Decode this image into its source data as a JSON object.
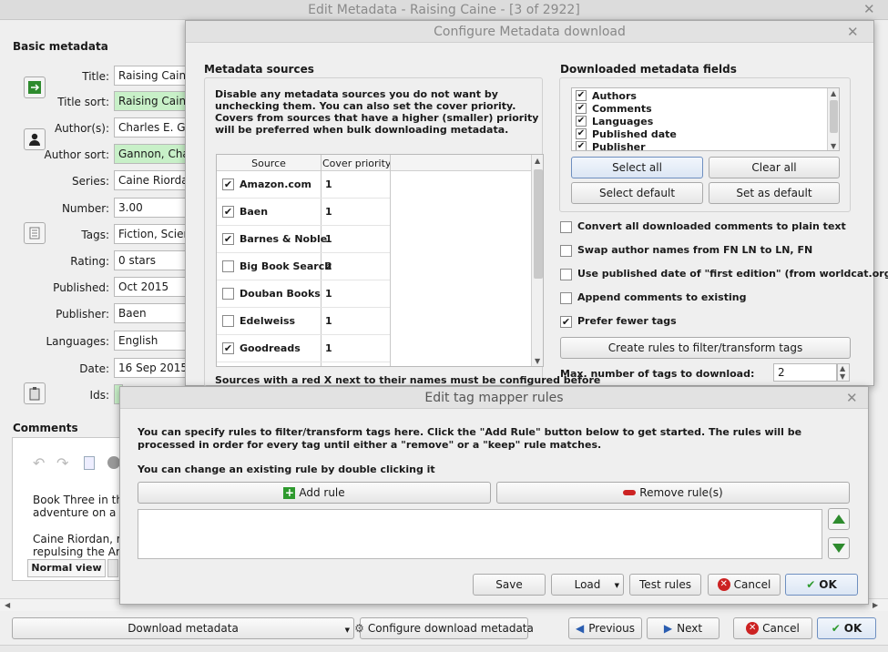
{
  "main_window": {
    "title": "Edit Metadata - Raising Caine -  [3 of 2922]"
  },
  "basic_metadata": {
    "heading": "Basic metadata",
    "labels": {
      "title": "Title:",
      "title_sort": "Title sort:",
      "authors": "Author(s):",
      "author_sort": "Author sort:",
      "series": "Series:",
      "number": "Number:",
      "tags": "Tags:",
      "rating": "Rating:",
      "published": "Published:",
      "publisher": "Publisher:",
      "languages": "Languages:",
      "date": "Date:",
      "ids": "Ids:"
    },
    "values": {
      "title": "Raising Caine",
      "title_sort": "Raising Caine",
      "authors": "Charles E. Gannon",
      "author_sort": "Gannon, Charles E.",
      "series": "Caine Riordan",
      "number": "3.00",
      "tags": "Fiction, Science Fiction",
      "rating": "0 stars",
      "published": "Oct 2015",
      "publisher": "Baen",
      "languages": "English",
      "date": "16 Sep 2015"
    }
  },
  "comments": {
    "heading": "Comments",
    "text1": "Book Three in the",
    "text2": "adventure on a gr",
    "text3": "Caine Riordan, rel",
    "text4": "repulsing the Ara",
    "normal_view_tab": "Normal view"
  },
  "bottom_bar": {
    "download_metadata": "Download metadata",
    "configure_download": "Configure download metadata",
    "previous": "Previous",
    "next": "Next",
    "cancel": "Cancel",
    "ok": "OK"
  },
  "configure_dialog": {
    "title": "Configure Metadata download",
    "sources_heading": "Metadata sources",
    "sources_desc": "Disable any metadata sources you do not want by unchecking them. You can also set the cover priority. Covers from sources that have a higher (smaller) priority will be preferred when bulk downloading metadata.",
    "col_source": "Source",
    "col_priority": "Cover priority",
    "sources": [
      {
        "name": "Amazon.com",
        "checked": true,
        "priority": "1"
      },
      {
        "name": "Baen",
        "checked": true,
        "priority": "1"
      },
      {
        "name": "Barnes & Noble",
        "checked": true,
        "priority": "1"
      },
      {
        "name": "Big Book Search",
        "checked": false,
        "priority": "2"
      },
      {
        "name": "Douban Books",
        "checked": false,
        "priority": "1"
      },
      {
        "name": "Edelweiss",
        "checked": false,
        "priority": "1"
      },
      {
        "name": "Goodreads",
        "checked": true,
        "priority": "1"
      }
    ],
    "sources_note": "Sources with a red X next to their names must be configured before",
    "fields_heading": "Downloaded metadata fields",
    "fields": [
      {
        "name": "Authors",
        "checked": true
      },
      {
        "name": "Comments",
        "checked": true
      },
      {
        "name": "Languages",
        "checked": true
      },
      {
        "name": "Published date",
        "checked": true
      },
      {
        "name": "Publisher",
        "checked": true
      }
    ],
    "select_all": "Select all",
    "clear_all": "Clear all",
    "select_default": "Select default",
    "set_as_default": "Set as default",
    "options": [
      {
        "label": "Convert all downloaded comments to plain text",
        "checked": false
      },
      {
        "label": "Swap author names from FN LN to LN, FN",
        "checked": false
      },
      {
        "label": "Use published date of \"first edition\" (from worldcat.org)",
        "checked": false
      },
      {
        "label": "Append comments to existing",
        "checked": false
      },
      {
        "label": "Prefer fewer tags",
        "checked": true
      }
    ],
    "create_rules": "Create rules to filter/transform tags",
    "max_tags_label": "Max. number of tags to download:",
    "max_tags_value": "2"
  },
  "tag_mapper": {
    "title": "Edit tag mapper rules",
    "desc": "You can specify rules to filter/transform tags here. Click the \"Add Rule\" button below to get started. The rules will be processed in order for every tag until either a \"remove\" or a \"keep\" rule matches.",
    "hint": "You can change an existing rule by double clicking it",
    "add_rule": "Add rule",
    "remove_rules": "Remove rule(s)",
    "save": "Save",
    "load": "Load",
    "test_rules": "Test rules",
    "cancel": "Cancel",
    "ok": "OK"
  },
  "colors": {
    "green_field": "#c8f0c8",
    "cancel_red": "#cc2222",
    "ok_green": "#2e9a2e",
    "arrow_green": "#2e8b2e"
  }
}
